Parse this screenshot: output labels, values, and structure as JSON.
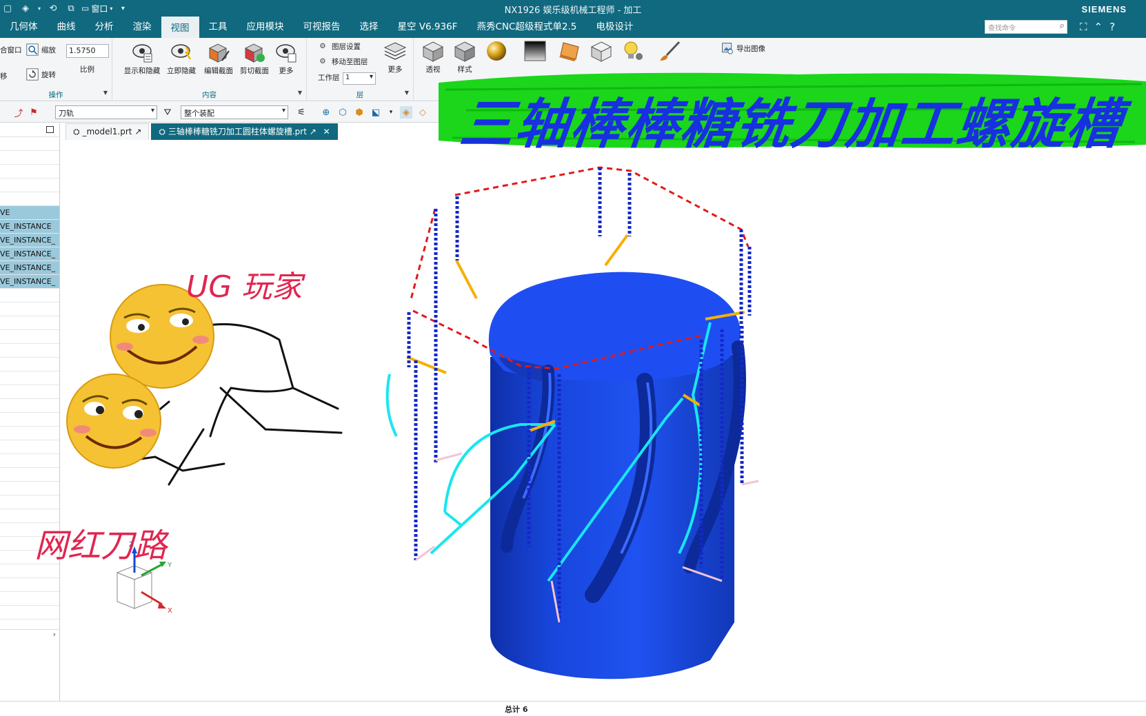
{
  "titlebar": {
    "window_menu": "窗口",
    "title": "NX1926 娱乐级机械工程师 - 加工",
    "brand": "SIEMENS"
  },
  "menu": {
    "tabs": [
      "几何体",
      "曲线",
      "分析",
      "渲染",
      "视图",
      "工具",
      "应用模块",
      "可视报告",
      "选择",
      "星空 V6.936F",
      "燕秀CNC超级程式单2.5",
      "电极设计"
    ],
    "active_tab": "视图",
    "search_placeholder": "查找命令"
  },
  "ribbon": {
    "operate": {
      "label": "操作",
      "fit_window": "合窗口",
      "zoom": "缩放",
      "scale_value": "1.5750",
      "scale_label": "比例",
      "move": "移",
      "rotate": "旋转"
    },
    "content": {
      "label": "内容",
      "show_hide": "显示和隐藏",
      "instant_hide": "立即隐藏",
      "edit_section": "编辑截面",
      "clip_section": "剪切截面",
      "more": "更多"
    },
    "layer": {
      "label": "层",
      "layer_settings": "图层设置",
      "move_to_layer": "移动至图层",
      "work_layer_label": "工作层",
      "work_layer_value": "1",
      "more": "更多"
    },
    "style": {
      "perspective": "透视",
      "style": "样式"
    },
    "export_image": "导出图像"
  },
  "selection_toolbar": {
    "filter_value": "刀轨",
    "scope_value": "整个装配"
  },
  "navigator": {
    "rows": [
      {
        "text": "",
        "selected": false
      },
      {
        "text": "",
        "selected": false
      },
      {
        "text": "",
        "selected": false
      },
      {
        "text": "",
        "selected": false
      },
      {
        "text": "",
        "selected": false
      },
      {
        "text": "VE",
        "selected": true
      },
      {
        "text": "VE_INSTANCE",
        "selected": true
      },
      {
        "text": "VE_INSTANCE_",
        "selected": true
      },
      {
        "text": "VE_INSTANCE_",
        "selected": true
      },
      {
        "text": "VE_INSTANCE_",
        "selected": true
      },
      {
        "text": "VE_INSTANCE_",
        "selected": true
      },
      {
        "text": "",
        "selected": false
      },
      {
        "text": "",
        "selected": false
      },
      {
        "text": "",
        "selected": false
      },
      {
        "text": "",
        "selected": false
      },
      {
        "text": "",
        "selected": false
      },
      {
        "text": "",
        "selected": false
      },
      {
        "text": "",
        "selected": false
      },
      {
        "text": "",
        "selected": false
      },
      {
        "text": "",
        "selected": false
      },
      {
        "text": "",
        "selected": false
      },
      {
        "text": "",
        "selected": false
      },
      {
        "text": "",
        "selected": false
      },
      {
        "text": "",
        "selected": false
      },
      {
        "text": "",
        "selected": false
      },
      {
        "text": "",
        "selected": false
      },
      {
        "text": "",
        "selected": false
      },
      {
        "text": "",
        "selected": false
      },
      {
        "text": "",
        "selected": false
      },
      {
        "text": "",
        "selected": false
      },
      {
        "text": "",
        "selected": false
      },
      {
        "text": "",
        "selected": false
      },
      {
        "text": "",
        "selected": false
      },
      {
        "text": "",
        "selected": false
      },
      {
        "text": "",
        "selected": false
      }
    ]
  },
  "doc_tabs": [
    {
      "label": "_model1.prt",
      "active": false
    },
    {
      "label": "三轴棒棒糖铣刀加工圆柱体螺旋槽.prt",
      "active": true
    }
  ],
  "overlay": {
    "title": "三轴棒棒糖铣刀加工螺旋槽",
    "ug_player": "UG 玩家",
    "viral_toolpath": "网红刀路"
  },
  "triad": {
    "z": "Z",
    "y": "Y",
    "x": "X"
  },
  "status": {
    "total": "总计 6"
  },
  "colors": {
    "titlebar": "#10697f",
    "part_blue": "#1446d8",
    "toolpath_red": "#e01a1a",
    "toolpath_blue": "#1428c8",
    "toolpath_cyan": "#19e6f0",
    "toolpath_orange": "#f5b000",
    "overlay_green": "#1bd61b",
    "overlay_text": "#1730e0",
    "label_pink": "#e0264f"
  }
}
